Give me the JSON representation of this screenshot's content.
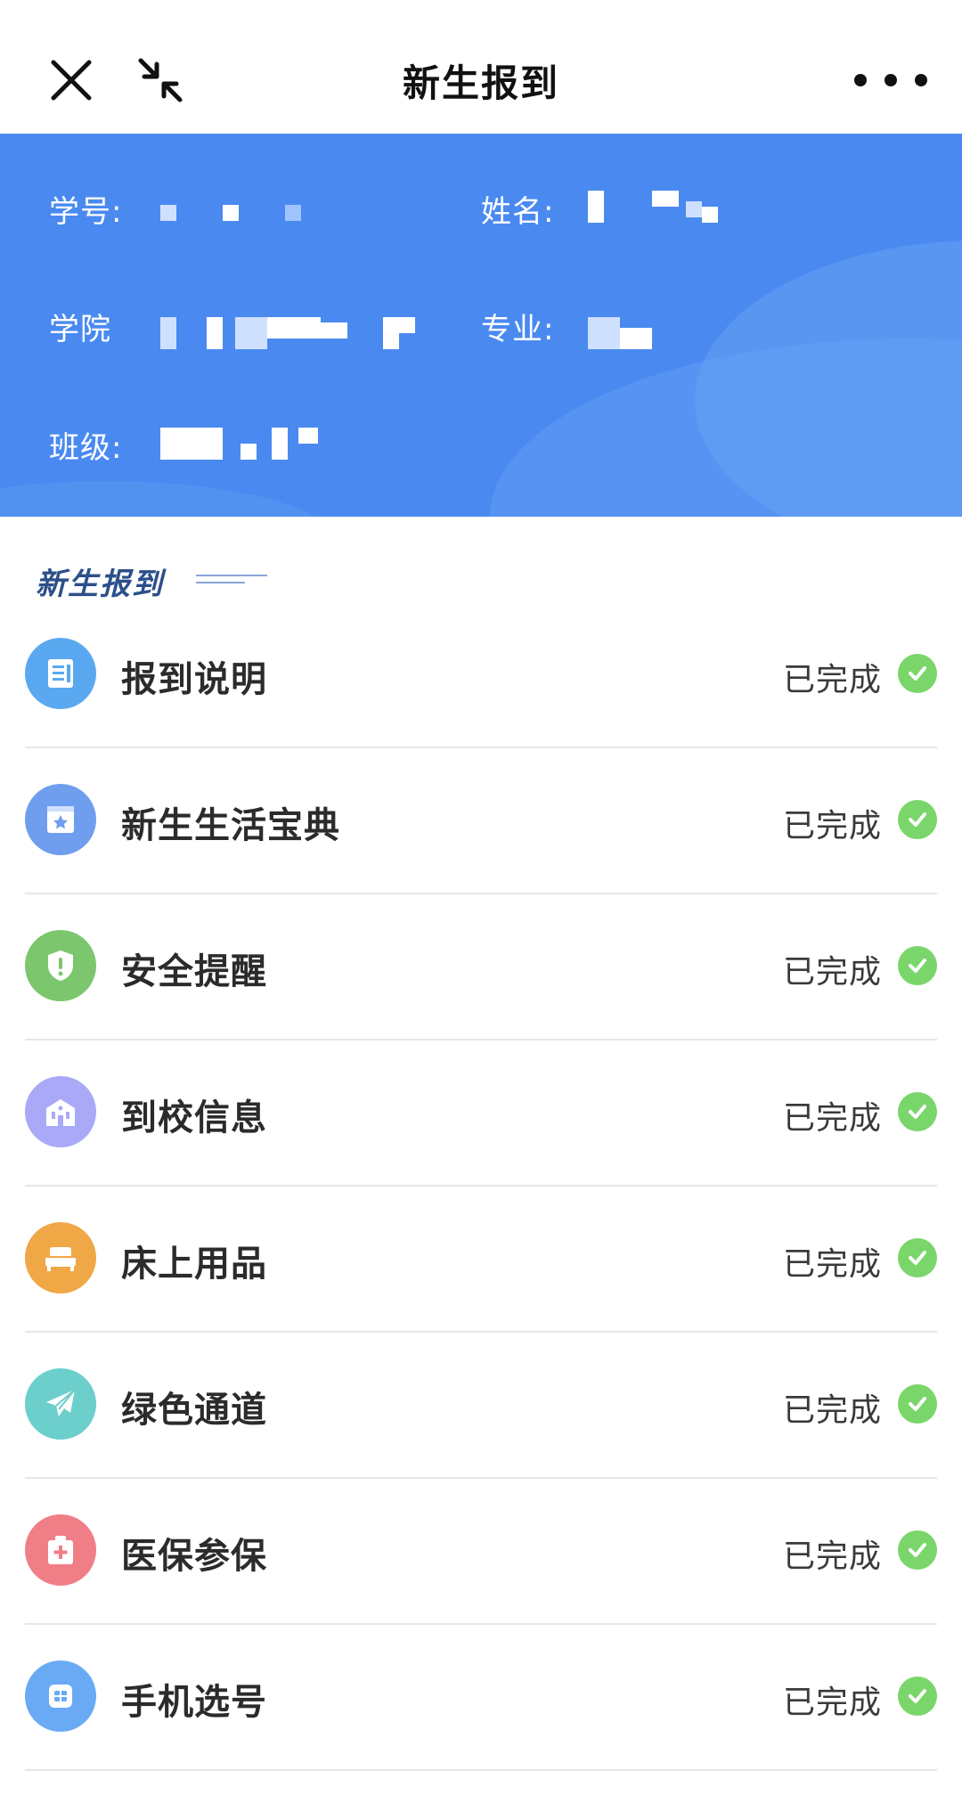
{
  "header": {
    "title": "新生报到",
    "close_icon": "close-icon",
    "minimize_icon": "minimize-icon",
    "more_icon": "more-dots-icon"
  },
  "info_card": {
    "student_id_label": "学号:",
    "name_label": "姓名:",
    "college_label": "学院",
    "major_label": "专业:",
    "class_label": "班级:",
    "background_color": "#4a8af0"
  },
  "section": {
    "title": "新生报到"
  },
  "tasks": [
    {
      "label": "报到说明",
      "status": "已完成",
      "icon": "document-icon",
      "color": "#5aa9f0"
    },
    {
      "label": "新生生活宝典",
      "status": "已完成",
      "icon": "star-book-icon",
      "color": "#6f9eee"
    },
    {
      "label": "安全提醒",
      "status": "已完成",
      "icon": "shield-alert-icon",
      "color": "#7cc66e"
    },
    {
      "label": "到校信息",
      "status": "已完成",
      "icon": "school-building-icon",
      "color": "#a9a9f7"
    },
    {
      "label": "床上用品",
      "status": "已完成",
      "icon": "bed-icon",
      "color": "#f0a746"
    },
    {
      "label": "绿色通道",
      "status": "已完成",
      "icon": "paper-plane-icon",
      "color": "#6ccfcc"
    },
    {
      "label": "医保参保",
      "status": "已完成",
      "icon": "medical-kit-icon",
      "color": "#f07e86"
    },
    {
      "label": "手机选号",
      "status": "已完成",
      "icon": "sim-card-icon",
      "color": "#6aaaf5"
    }
  ],
  "status_color": "#7ad66a"
}
